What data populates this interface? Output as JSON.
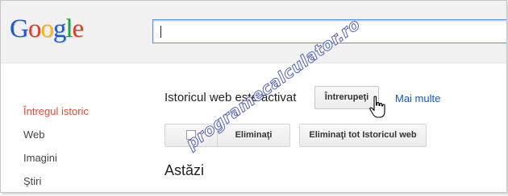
{
  "header": {
    "logo_letters": [
      "G",
      "o",
      "o",
      "g",
      "l",
      "e"
    ],
    "search": {
      "value": ""
    }
  },
  "sidebar": {
    "items": [
      {
        "label": "Întregul istoric",
        "active": true
      },
      {
        "label": "Web"
      },
      {
        "label": "Imagini"
      },
      {
        "label": "Ştiri"
      }
    ]
  },
  "main": {
    "status_text": "Istoricul web este activat",
    "pause_button": "Întrerupeţi",
    "more_link": "Mai multe",
    "delete_button": "Eliminaţi",
    "delete_all_button": "Eliminaţi tot Istoricul web",
    "section_title": "Astăzi"
  },
  "watermark": "programecalculator.ro",
  "colors": {
    "active_nav": "#dd4b39",
    "link": "#1155cc",
    "search_border": "#4d90fe"
  }
}
